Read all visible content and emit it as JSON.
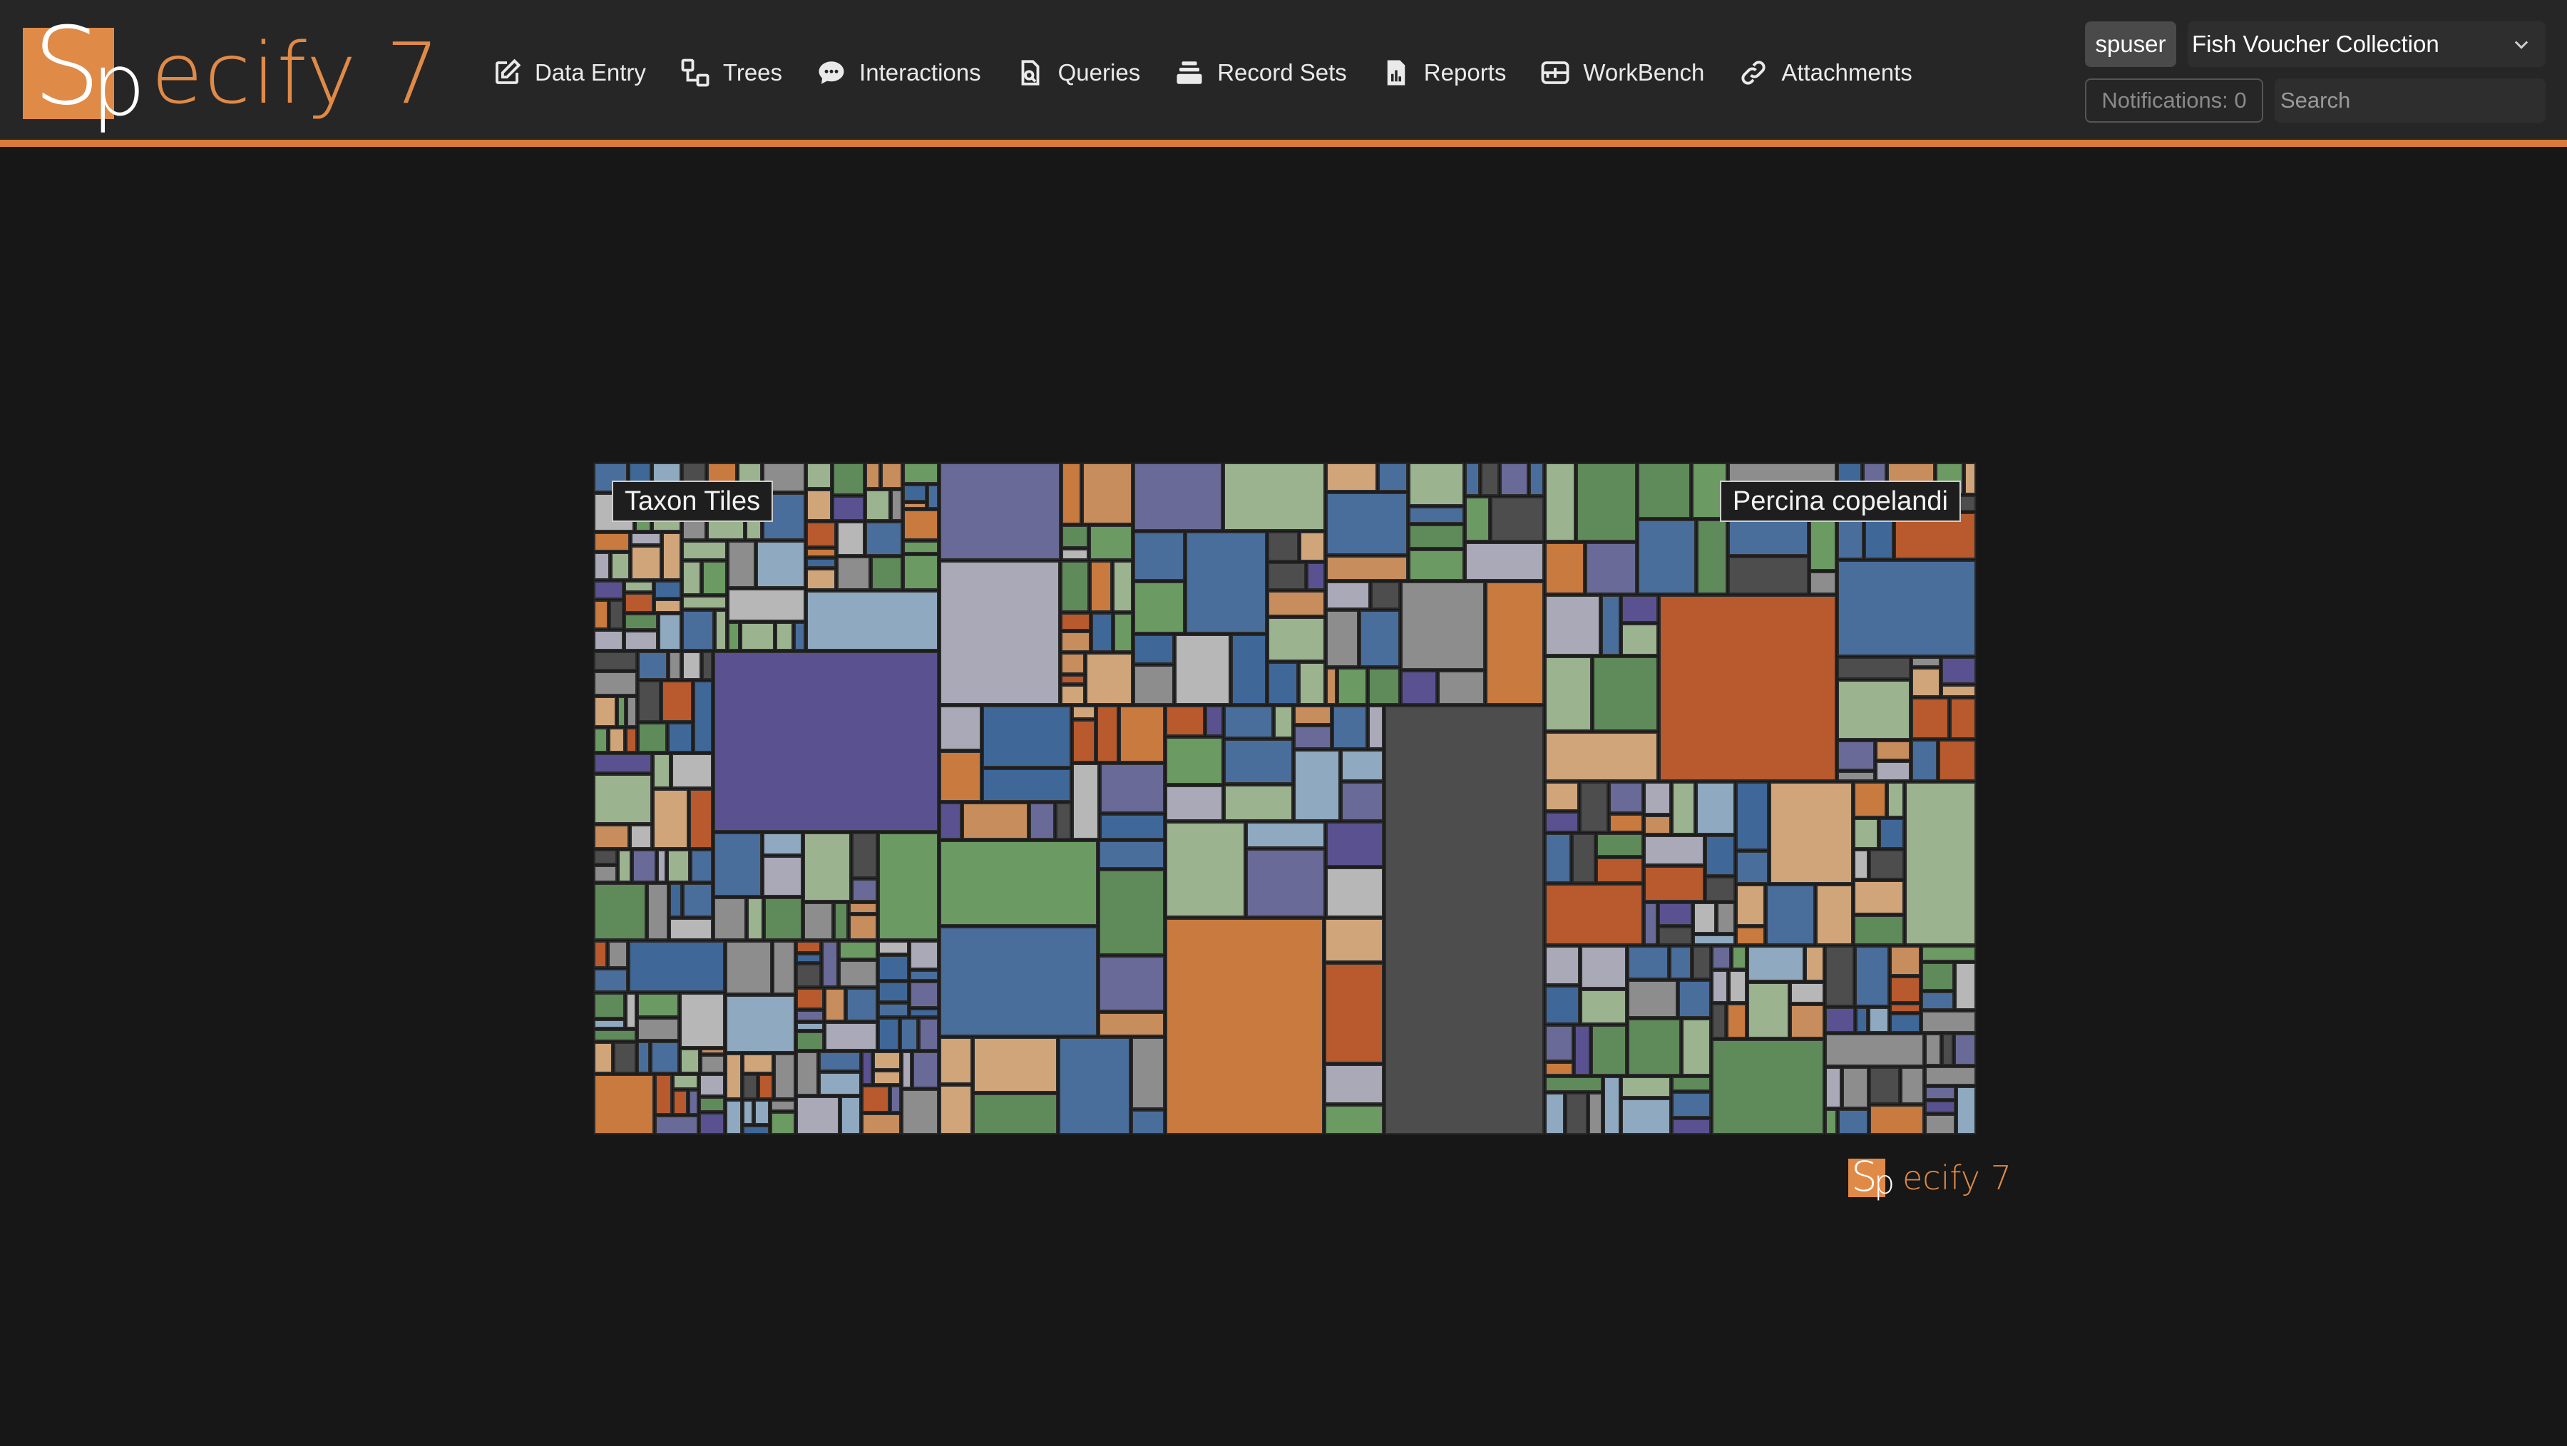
{
  "app": {
    "logo_s": "S",
    "logo_p": "p",
    "logo_rest": "ecify 7"
  },
  "nav": {
    "items": [
      {
        "label": "Data Entry",
        "icon": "edit-icon"
      },
      {
        "label": "Trees",
        "icon": "tree-icon"
      },
      {
        "label": "Interactions",
        "icon": "chat-icon"
      },
      {
        "label": "Queries",
        "icon": "query-icon"
      },
      {
        "label": "Record Sets",
        "icon": "stack-icon"
      },
      {
        "label": "Reports",
        "icon": "report-icon"
      },
      {
        "label": "WorkBench",
        "icon": "workbench-icon"
      },
      {
        "label": "Attachments",
        "icon": "link-icon"
      }
    ]
  },
  "user": {
    "name": "spuser",
    "collection": "Fish Voucher Collection",
    "notifications": "Notifications: 0",
    "search_placeholder": "Search"
  },
  "treemap": {
    "title": "Taxon Tiles",
    "hover_label": "Percina copelandi",
    "palette": [
      "#4a6e9c",
      "#6b9a63",
      "#c97a3e",
      "#8d8d8d",
      "#a9a9b8",
      "#5a5290",
      "#4d4d4d",
      "#b85a2e",
      "#d1a57a",
      "#8faac0",
      "#3f6899",
      "#5f8b5a",
      "#b7b7b7",
      "#6a6a98",
      "#9bb38f",
      "#c88d5c"
    ]
  },
  "footer": {
    "logo_s": "S",
    "logo_p": "p",
    "logo_rest": "ecify 7"
  }
}
